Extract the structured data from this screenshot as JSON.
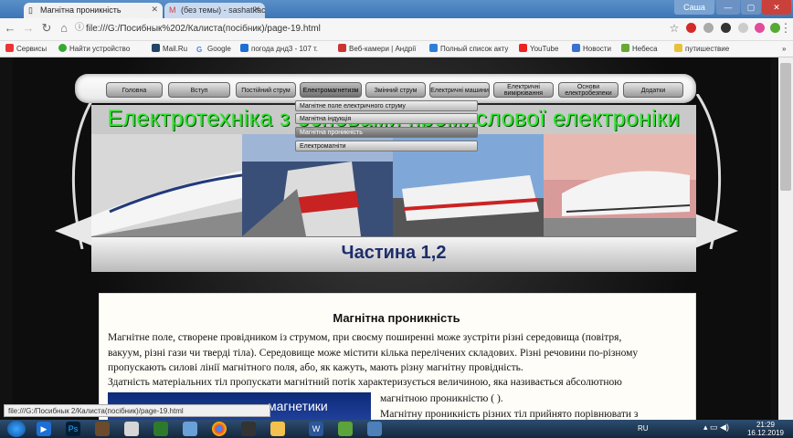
{
  "browser": {
    "tabs": [
      {
        "title": "Магнітна проникність",
        "active": true
      },
      {
        "title": "(без темы) - sashatkach",
        "active": false
      }
    ],
    "window_user": "Саша",
    "url": "file:///G:/Посибнык%202/Калиста(посібник)/page-19.html",
    "bookmarks": [
      "Сервисы",
      "Найти устройство",
      "Mail.Ru",
      "Google",
      "погода днд3 - 107 т.",
      "Веб-камери | Андрії",
      "Полный список акту",
      "YouTube",
      "Новости",
      "Небеса",
      "путишествие"
    ]
  },
  "site": {
    "menu": [
      "Головна",
      "Вступ",
      "Постійний струм",
      "Електромагнетизм",
      "Змінний струм",
      "Електричні машини",
      "Електричні вимірювання",
      "Основи електробезпеки",
      "Додатки"
    ],
    "dropdown": [
      "Магнітне поле електричного струму",
      "Магнітна індукція",
      "Магнітна проникність",
      "Електромагніти"
    ],
    "banner_title": "Електротехніка з основами промислової електроніки",
    "part_label": "Частина 1,2"
  },
  "article": {
    "title": "Магнітна проникність",
    "lines": [
      "Магнітне поле, створене провідником із струмом, при своєму поширенні може зустріти різні середовища (повітря,",
      "вакуум, різні гази чи тверді тіла). Середовище може містити кілька перелічених складових. Різні речовини по-різному",
      "пропускають силові лінії магнітного поля, або, як кажуть, мають різну магнітну провідність.",
      "Здатність матеріальних тіл пропускати магнітний потік характеризується величиною, яка називається абсолютною"
    ],
    "side_lines": [
      "магнітною проникністю ( ).",
      "Магнітну проникність різних тіл прийнято порівнювати з"
    ],
    "image_caption": "магнетики"
  },
  "status_url": "file:///G:/Посибнык 2/Калиста(посібник)/page-19.html",
  "taskbar": {
    "lang": "RU",
    "time": "21:29",
    "date": "16.12.2019"
  }
}
